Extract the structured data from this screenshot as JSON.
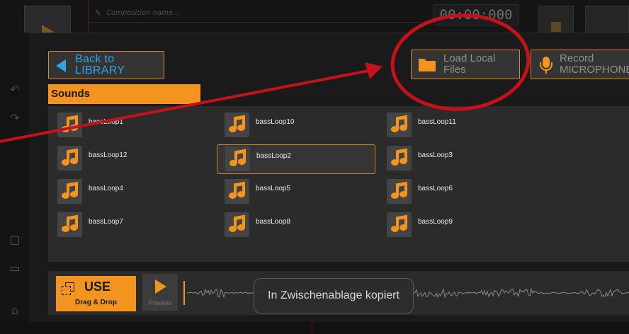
{
  "background": {
    "composition_placeholder": "Composition name...",
    "timer": "00:00:000"
  },
  "modal": {
    "back_button": {
      "line1": "Back to",
      "line2": "LIBRARY"
    },
    "load_button": {
      "line1": "Load Local",
      "line2": "Files"
    },
    "record_button": {
      "line1": "Record",
      "line2": "MICROPHONE"
    },
    "section_title": "Sounds",
    "sounds": [
      {
        "name": "bassLoop1",
        "selected": false
      },
      {
        "name": "bassLoop10",
        "selected": false
      },
      {
        "name": "bassLoop11",
        "selected": false
      },
      {
        "name": "bassLoop12",
        "selected": false
      },
      {
        "name": "bassLoop2",
        "selected": true
      },
      {
        "name": "bassLoop3",
        "selected": false
      },
      {
        "name": "bassLoop4",
        "selected": false
      },
      {
        "name": "bassLoop5",
        "selected": false
      },
      {
        "name": "bassLoop6",
        "selected": false
      },
      {
        "name": "bassLoop7",
        "selected": false
      },
      {
        "name": "bassLoop8",
        "selected": false
      },
      {
        "name": "bassLoop9",
        "selected": false
      }
    ],
    "use_button": {
      "title": "USE",
      "subtitle": "Drag & Drop"
    },
    "preview_button": {
      "label": "Preview"
    },
    "toast": "In Zwischenablage kopiert"
  },
  "colors": {
    "accent": "#f3941e",
    "link_blue": "#2ea6e6",
    "annotation_red": "#c4121a"
  },
  "icons": {
    "back": "back-arrow-icon",
    "load": "folder-icon",
    "record": "microphone-icon",
    "sound": "music-note-icon",
    "use": "copy-icon",
    "preview": "play-icon"
  }
}
